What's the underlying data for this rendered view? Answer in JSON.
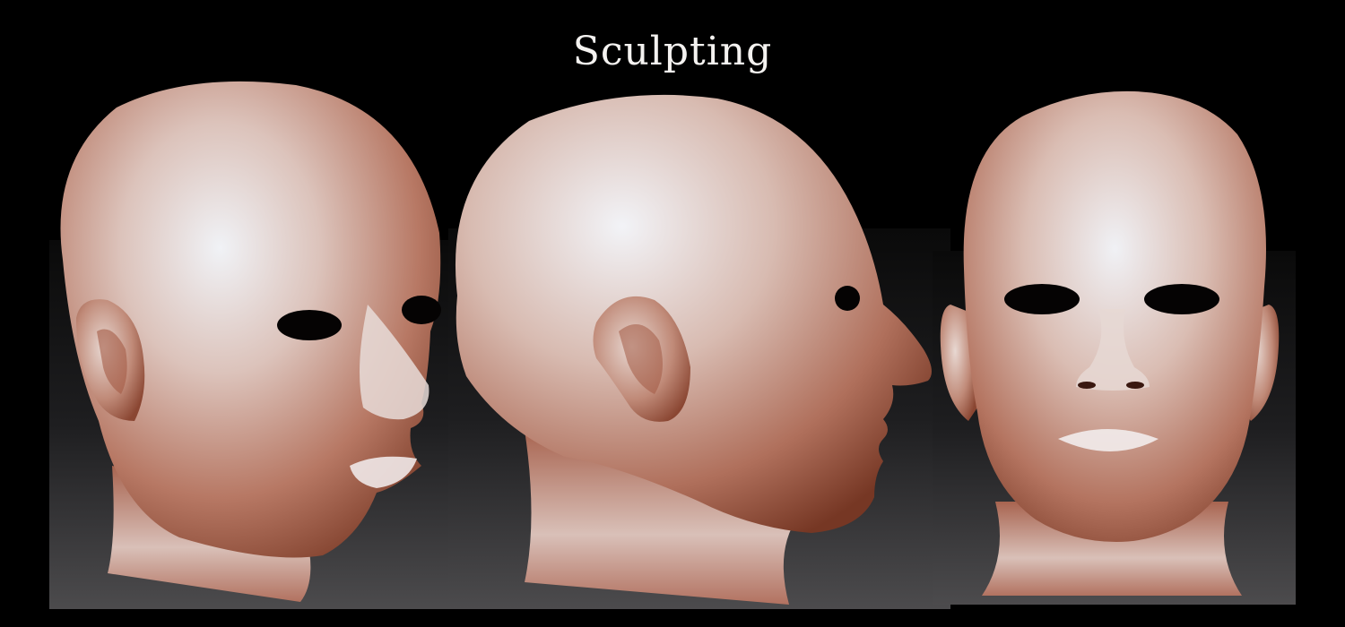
{
  "title": "Sculpting",
  "colors": {
    "background": "#000000",
    "panel_top": "#0c0c0c",
    "panel_bottom": "#4b4a4c",
    "clay_highlight": "#eef0f4",
    "clay_mid": "#c58e7c",
    "clay_shadow": "#7a3a26",
    "eye_hole": "#050303"
  },
  "views": [
    {
      "name": "three-quarter-view"
    },
    {
      "name": "side-view"
    },
    {
      "name": "front-view"
    }
  ]
}
